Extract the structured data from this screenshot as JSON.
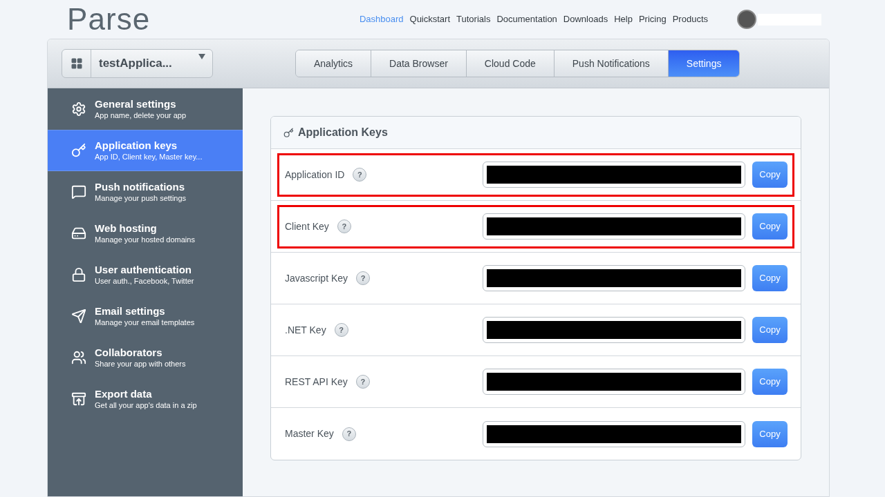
{
  "logo": "Parse",
  "nav": [
    {
      "label": "Dashboard",
      "selected": true
    },
    {
      "label": "Quickstart",
      "selected": false
    },
    {
      "label": "Tutorials",
      "selected": false
    },
    {
      "label": "Documentation",
      "selected": false
    },
    {
      "label": "Downloads",
      "selected": false
    },
    {
      "label": "Help",
      "selected": false
    },
    {
      "label": "Pricing",
      "selected": false
    },
    {
      "label": "Products",
      "selected": false
    }
  ],
  "app_selector": {
    "value": "testApplica..."
  },
  "tabs": [
    {
      "label": "Analytics",
      "selected": false
    },
    {
      "label": "Data Browser",
      "selected": false
    },
    {
      "label": "Cloud Code",
      "selected": false
    },
    {
      "label": "Push Notifications",
      "selected": false
    },
    {
      "label": "Settings",
      "selected": true
    }
  ],
  "sidebar": {
    "items": [
      {
        "title": "General settings",
        "subtitle": "App name, delete your app",
        "selected": false
      },
      {
        "title": "Application keys",
        "subtitle": "App ID, Client key, Master key...",
        "selected": true
      },
      {
        "title": "Push notifications",
        "subtitle": "Manage your push settings",
        "selected": false
      },
      {
        "title": "Web hosting",
        "subtitle": "Manage your hosted domains",
        "selected": false
      },
      {
        "title": "User authentication",
        "subtitle": "User auth., Facebook, Twitter",
        "selected": false
      },
      {
        "title": "Email settings",
        "subtitle": "Manage your email templates",
        "selected": false
      },
      {
        "title": "Collaborators",
        "subtitle": "Share your app with others",
        "selected": false
      },
      {
        "title": "Export data",
        "subtitle": "Get all your app's data in a zip",
        "selected": false
      }
    ]
  },
  "panel": {
    "title": "Application Keys",
    "keys": [
      {
        "label": "Application ID",
        "help": "?",
        "button": "Copy",
        "highlighted": true,
        "redacted": true
      },
      {
        "label": "Client Key",
        "help": "?",
        "button": "Copy",
        "highlighted": true,
        "redacted": true
      },
      {
        "label": "Javascript Key",
        "help": "?",
        "button": "Copy",
        "highlighted": false,
        "redacted": true
      },
      {
        "label": ".NET Key",
        "help": "?",
        "button": "Copy",
        "highlighted": false,
        "redacted": true
      },
      {
        "label": "REST API Key",
        "help": "?",
        "button": "Copy",
        "highlighted": false,
        "redacted": true
      },
      {
        "label": "Master Key",
        "help": "?",
        "button": "Copy",
        "highlighted": false,
        "redacted": true
      }
    ]
  }
}
